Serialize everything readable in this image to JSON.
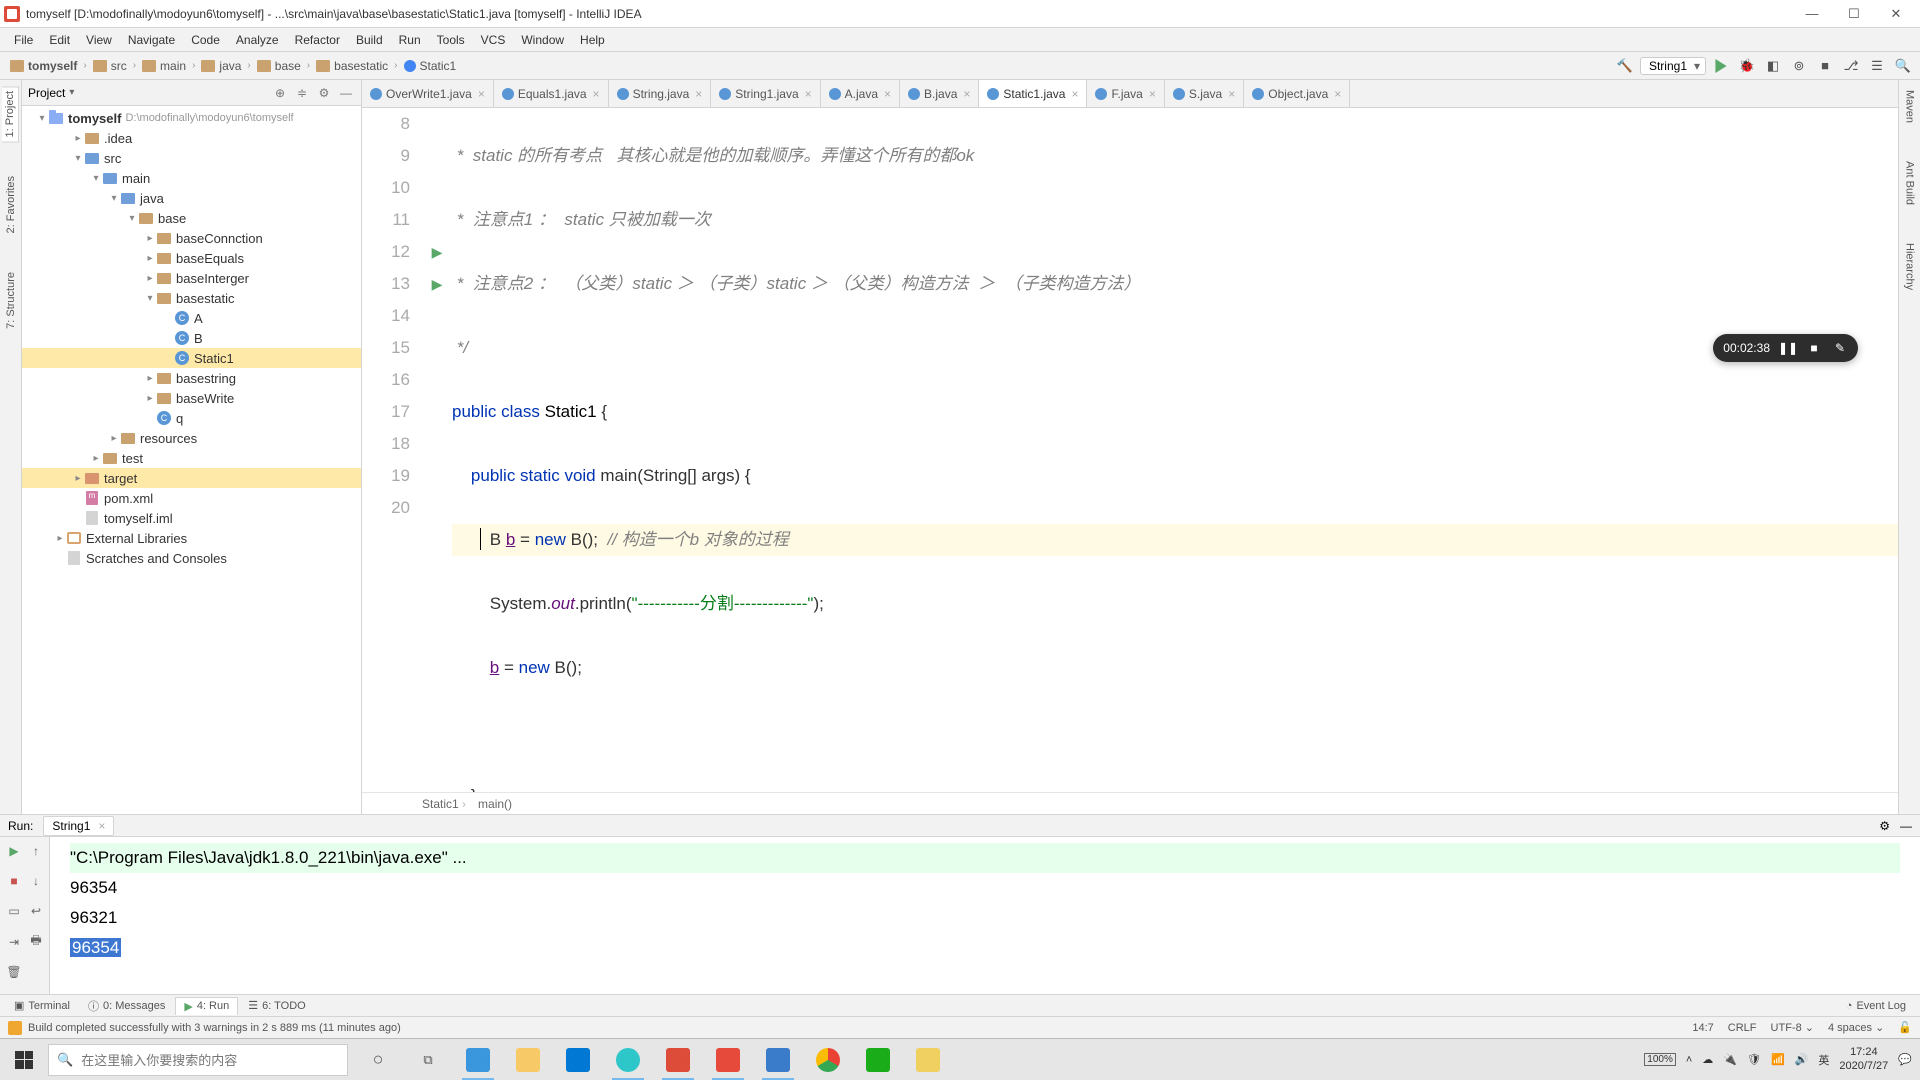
{
  "title": "tomyself [D:\\modofinally\\modoyun6\\tomyself] - ...\\src\\main\\java\\base\\basestatic\\Static1.java [tomyself] - IntelliJ IDEA",
  "menu": [
    "File",
    "Edit",
    "View",
    "Navigate",
    "Code",
    "Analyze",
    "Refactor",
    "Build",
    "Run",
    "Tools",
    "VCS",
    "Window",
    "Help"
  ],
  "breadcrumb": {
    "items": [
      "tomyself",
      "src",
      "main",
      "java",
      "base",
      "basestatic",
      "Static1"
    ]
  },
  "run_config": "String1",
  "project": {
    "title": "Project",
    "root": {
      "label": "tomyself",
      "path": "D:\\modofinally\\modoyun6\\tomyself"
    },
    "tree": [
      {
        "label": ".idea",
        "kind": "dir",
        "indent": 2,
        "chev": "▸"
      },
      {
        "label": "src",
        "kind": "src",
        "indent": 2,
        "chev": "▾"
      },
      {
        "label": "main",
        "kind": "src",
        "indent": 3,
        "chev": "▾"
      },
      {
        "label": "java",
        "kind": "src",
        "indent": 4,
        "chev": "▾"
      },
      {
        "label": "base",
        "kind": "pkg",
        "indent": 5,
        "chev": "▾"
      },
      {
        "label": "baseConnction",
        "kind": "pkg",
        "indent": 6,
        "chev": "▸"
      },
      {
        "label": "baseEquals",
        "kind": "pkg",
        "indent": 6,
        "chev": "▸"
      },
      {
        "label": "baseInterger",
        "kind": "pkg",
        "indent": 6,
        "chev": "▸"
      },
      {
        "label": "basestatic",
        "kind": "pkg",
        "indent": 6,
        "chev": "▾"
      },
      {
        "label": "A",
        "kind": "class",
        "indent": 7
      },
      {
        "label": "B",
        "kind": "class",
        "indent": 7
      },
      {
        "label": "Static1",
        "kind": "class",
        "indent": 7,
        "selected": true
      },
      {
        "label": "basestring",
        "kind": "pkg",
        "indent": 6,
        "chev": "▸"
      },
      {
        "label": "baseWrite",
        "kind": "pkg",
        "indent": 6,
        "chev": "▸"
      },
      {
        "label": "q",
        "kind": "class",
        "indent": 6
      },
      {
        "label": "resources",
        "kind": "dir",
        "indent": 4,
        "chev": "▸"
      },
      {
        "label": "test",
        "kind": "dir",
        "indent": 3,
        "chev": "▸"
      },
      {
        "label": "target",
        "kind": "orange",
        "indent": 2,
        "chev": "▸",
        "selected": true
      },
      {
        "label": "pom.xml",
        "kind": "xml",
        "indent": 2
      },
      {
        "label": "tomyself.iml",
        "kind": "file",
        "indent": 2
      },
      {
        "label": "External Libraries",
        "kind": "lib",
        "indent": 1,
        "chev": "▸"
      },
      {
        "label": "Scratches and Consoles",
        "kind": "scratch",
        "indent": 1
      }
    ]
  },
  "editor": {
    "tabs": [
      {
        "label": "OverWrite1.java"
      },
      {
        "label": "Equals1.java"
      },
      {
        "label": "String.java"
      },
      {
        "label": "String1.java"
      },
      {
        "label": "A.java"
      },
      {
        "label": "B.java"
      },
      {
        "label": "Static1.java",
        "active": true
      },
      {
        "label": "F.java"
      },
      {
        "label": "S.java"
      },
      {
        "label": "Object.java"
      }
    ],
    "first_line": 8,
    "code": {
      "l8": " *  static 的所有考点   其核心就是他的加载顺序。弄懂这个所有的都ok",
      "l9": " *  注意点1 ：  static 只被加载一次",
      "l10": " *  注意点2 ：  （父类）static ＞ （子类）static ＞ （父类）构造方法  ＞  （子类构造方法）",
      "l11": " */",
      "l12_kw_public": "public",
      "l12_kw_class": "class",
      "l12_name": "Static1",
      "l13_kw_psvm": "public static void",
      "l13_main": "main",
      "l13_args": "(String[] args) {",
      "l14_type": "B ",
      "l14_var": "b",
      "l14_eq": " = ",
      "l14_new": "new",
      "l14_rest": " B();  ",
      "l14_comment": "// 构造一个b 对象的过程",
      "l15_a": "System.",
      "l15_out": "out",
      "l15_b": ".println(",
      "l15_str": "\"-----------分割-------------\"",
      "l15_c": ");",
      "l16_var": "b",
      "l16_eq": " = ",
      "l16_new": "new",
      "l16_rest": " B();"
    },
    "breadcrumb": [
      "Static1",
      "main()"
    ],
    "caret_pos": "14:7"
  },
  "recorder": {
    "time": "00:02:38"
  },
  "run": {
    "label": "Run:",
    "tab": "String1",
    "output": {
      "cmd": "\"C:\\Program Files\\Java\\jdk1.8.0_221\\bin\\java.exe\" ...",
      "l2": "96354",
      "l3": "96321",
      "l4": "96354"
    }
  },
  "bottom_tabs": {
    "terminal": "Terminal",
    "messages": "0: Messages",
    "run": "4: Run",
    "todo": "6: TODO",
    "event_log": "Event Log"
  },
  "status": {
    "msg": "Build completed successfully with 3 warnings in 2 s 889 ms (11 minutes ago)",
    "pos": "14:7",
    "crlf": "CRLF",
    "enc": "UTF-8",
    "indent": "4 spaces"
  },
  "taskbar": {
    "search_placeholder": "在这里输入你要搜索的内容",
    "battery": "100%",
    "ime": "英",
    "time": "17:24",
    "date": "2020/7/27"
  },
  "side": {
    "left1": "1: Project",
    "left2": "2: Favorites",
    "left3": "7: Structure",
    "right1": "Maven",
    "right2": "Ant Build",
    "right3": "Hierarchy"
  }
}
